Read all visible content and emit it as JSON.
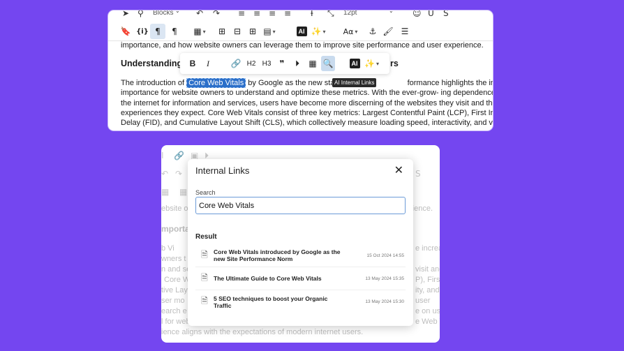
{
  "editor": {
    "toolbar_row1": {
      "blocks_label": "Blocks",
      "font_size_label": "12pt"
    },
    "toolbar_row2": {
      "ai_label": "AI"
    },
    "content": {
      "line_intro_tail": "importance, and how website owners can leverage them to improve site performance and user experience.",
      "heading_start": "Understanding",
      "heading_end": "rs",
      "para": {
        "pre": "The introduction of ",
        "highlight": "Core Web Vitals",
        "post": " by Google as the new standard",
        "post2": "formance highlights the increasing",
        "line2": "importance for website owners to understand and optimize these metrics. With the ever-grow- ing dependence on",
        "line3": "the internet for information and services, users have become more discerning of the websites they visit and the",
        "line4": "experiences they expect. Core Web Vitals consist of three key metrics: Largest Contentful Paint (LCP), First Input",
        "line5": "Delay (FID), and Cumulative Layout Shift (CLS), which collectively measure loading speed, interactivity, and visual"
      }
    },
    "floating_toolbar": {
      "h2": "H2",
      "h3": "H3",
      "ai_label": "AI"
    },
    "tooltip": "AI Internal Links"
  },
  "background_editor": {
    "lines": [
      "ebsite ow",
      "rience.",
      "mporta",
      "b Vi",
      "e increa",
      "wners t",
      "n and se",
      "visit and th",
      "Core W",
      "P), First",
      "tive Lay",
      "ity, and",
      "ser mo",
      "user",
      "earch e",
      "e on us",
      "l for web",
      "e Web Vi",
      "ience aligns with the expectations of modern internet users."
    ]
  },
  "modal": {
    "title": "Internal Links",
    "search_label": "Search",
    "search_value": "Core Web Vitals",
    "result_label": "Result",
    "results": [
      {
        "title": "Core Web Vitals introduced by Google as the new Site Performance Norm",
        "date": "15 Oct 2024 14:55"
      },
      {
        "title": "The Ultimate Guide to Core Web Vitals",
        "date": "13 May 2024 15:35"
      },
      {
        "title": "5 SEO techniques to boost your Organic Traffic",
        "date": "13 May 2024 15:30"
      }
    ]
  },
  "colors": {
    "background": "#7446f0",
    "highlight": "#2b6fc9",
    "active_button": "#dbe6f3",
    "input_border": "#6b9bd8"
  }
}
